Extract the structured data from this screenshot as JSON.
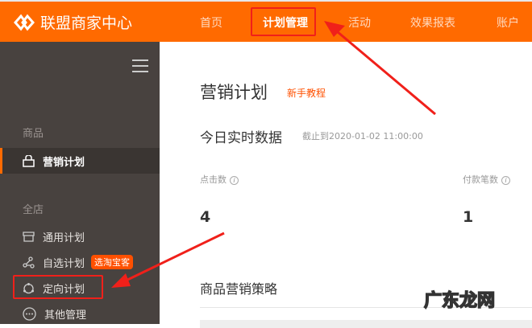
{
  "header": {
    "brand": "联盟商家中心",
    "nav": [
      {
        "label": "首页"
      },
      {
        "label": "计划管理",
        "active": true
      },
      {
        "label": "活动"
      },
      {
        "label": "效果报表"
      },
      {
        "label": "账户"
      }
    ],
    "accent": "#ff6a00"
  },
  "sidebar": {
    "sections": [
      {
        "title": "商品",
        "items": [
          {
            "label": "营销计划",
            "icon": "bag-icon",
            "active": true
          }
        ]
      },
      {
        "title": "全店",
        "items": [
          {
            "label": "通用计划",
            "icon": "store-icon"
          },
          {
            "label": "自选计划",
            "icon": "share-icon",
            "badge": "选淘宝客"
          },
          {
            "label": "定向计划",
            "icon": "target-icon"
          },
          {
            "label": "其他管理",
            "icon": "more-icon"
          }
        ]
      }
    ]
  },
  "main": {
    "title": "营销计划",
    "tutorial": "新手教程",
    "realtime_title": "今日实时数据",
    "timestamp": "截止到2020-01-02 11:00:00",
    "metrics": [
      {
        "label": "点击数",
        "value": "4"
      },
      {
        "label": "付款笔数",
        "value": "1"
      }
    ],
    "strategy_title": "商品营销策略"
  },
  "watermark": "广东龙网"
}
